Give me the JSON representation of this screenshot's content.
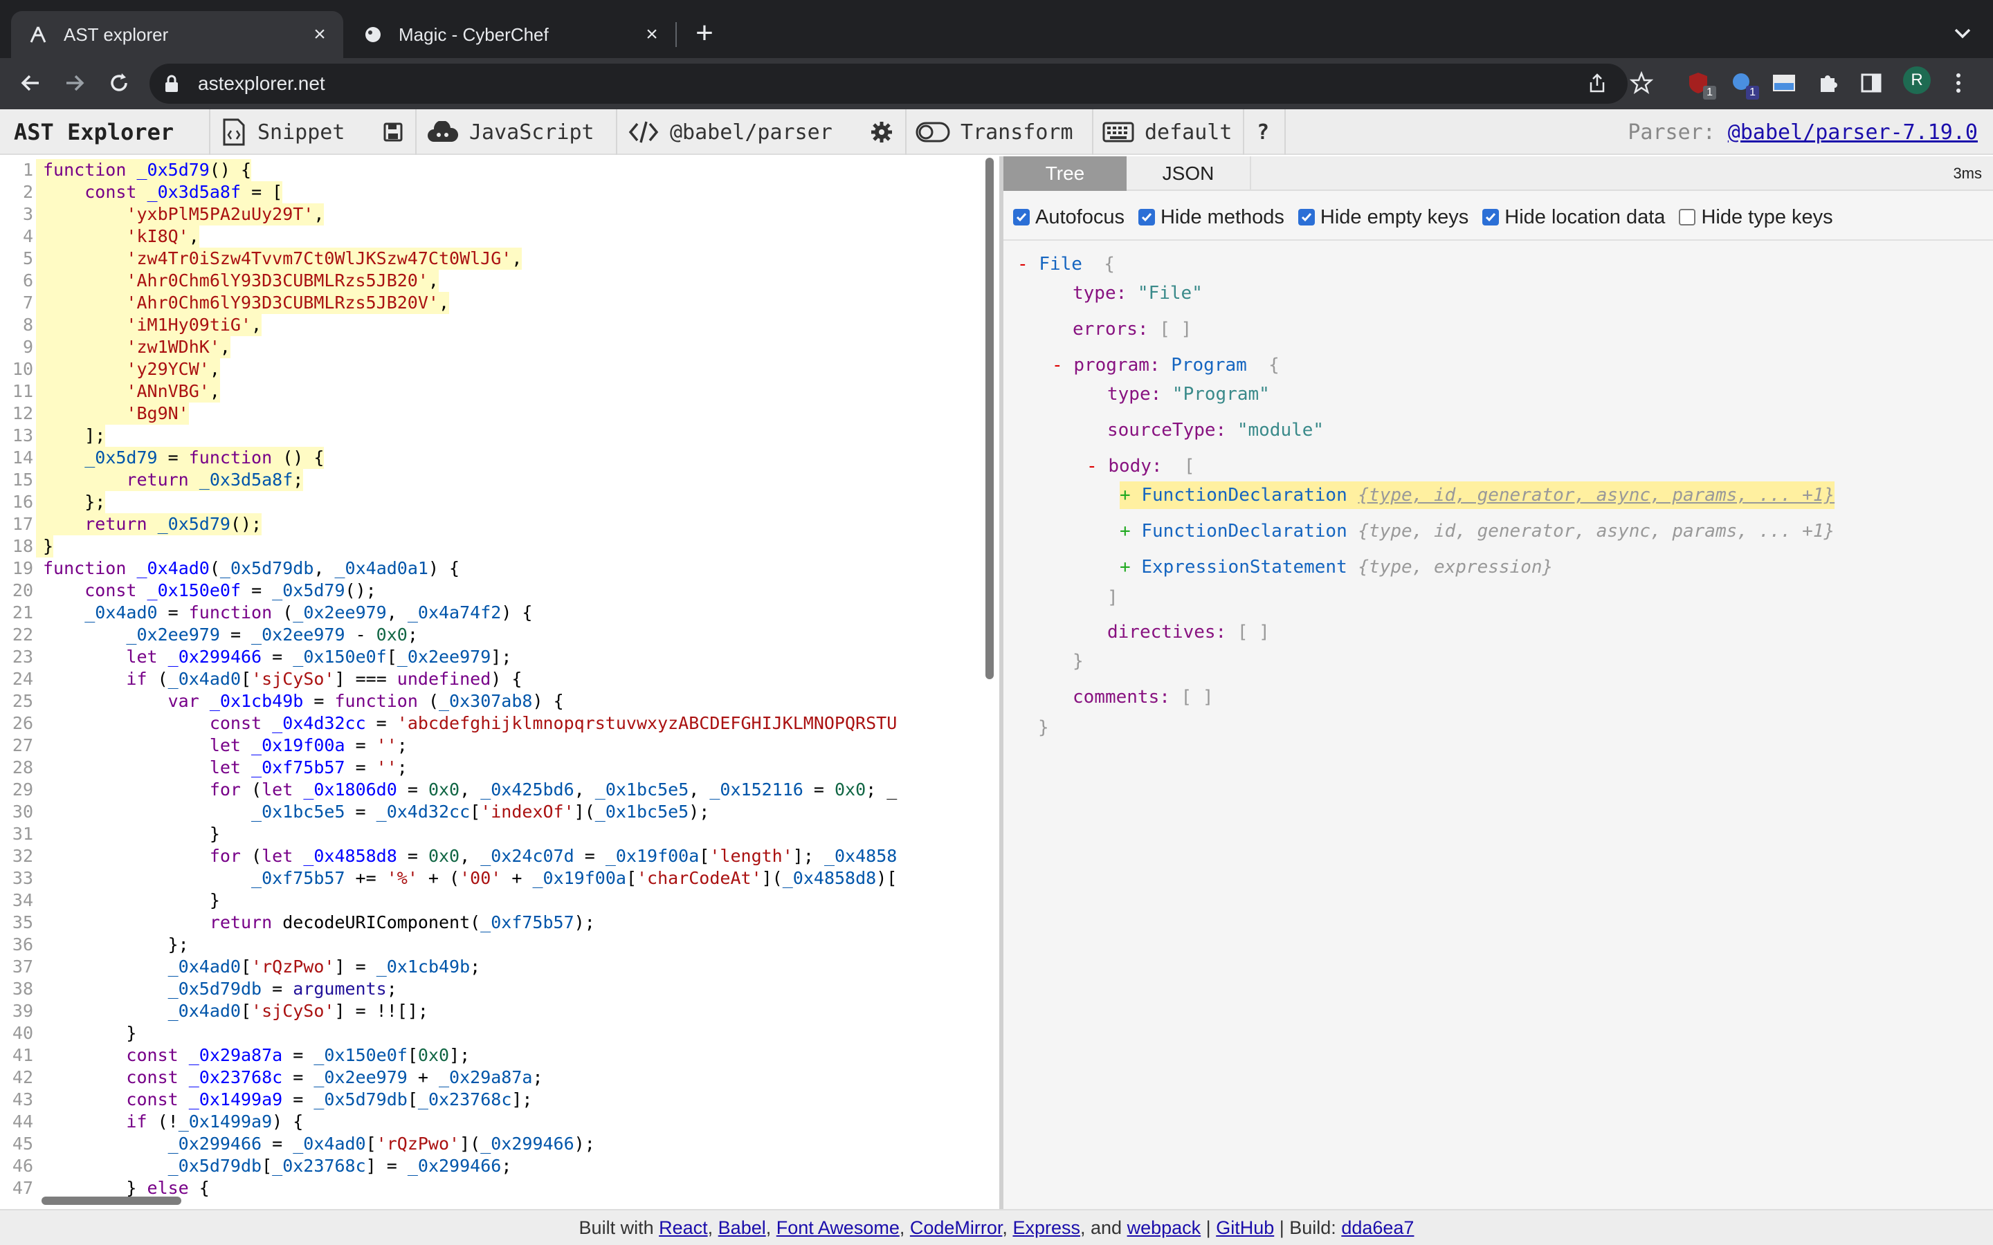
{
  "browser": {
    "tabs": [
      {
        "title": "AST explorer"
      },
      {
        "title": "Magic - CyberChef"
      }
    ],
    "url": "astexplorer.net",
    "extensions": [
      {
        "name": "ublock-icon",
        "badge": "1"
      },
      {
        "name": "extension-icon",
        "badge": "1"
      },
      {
        "name": "video-extension-icon",
        "badge": ""
      }
    ],
    "avatar_letter": "R"
  },
  "app": {
    "brand": "AST Explorer",
    "snippet": "Snippet",
    "language": "JavaScript",
    "parser": "@babel/parser",
    "transform": "Transform",
    "keymap": "default",
    "help": "?",
    "parser_label": "Parser:",
    "parser_version": "@babel/parser-7.19.0"
  },
  "editor": {
    "lines": [
      "function _0x5d79() {",
      "    const _0x3d5a8f = [",
      "        'yxbPlM5PA2uUy29T',",
      "        'kI8Q',",
      "        'zw4Tr0iSzw4Tvvm7Ct0WlJKSzw47Ct0WlJG',",
      "        'Ahr0Chm6lY93D3CUBMLRzs5JB20',",
      "        'Ahr0Chm6lY93D3CUBMLRzs5JB20V',",
      "        'iM1Hy09tiG',",
      "        'zw1WDhK',",
      "        'y29YCW',",
      "        'ANnVBG',",
      "        'Bg9N'",
      "    ];",
      "    _0x5d79 = function () {",
      "        return _0x3d5a8f;",
      "    };",
      "    return _0x5d79();",
      "}",
      "function _0x4ad0(_0x5d79db, _0x4ad0a1) {",
      "    const _0x150e0f = _0x5d79();",
      "    _0x4ad0 = function (_0x2ee979, _0x4a74f2) {",
      "        _0x2ee979 = _0x2ee979 - 0x0;",
      "        let _0x299466 = _0x150e0f[_0x2ee979];",
      "        if (_0x4ad0['sjCySo'] === undefined) {",
      "            var _0x1cb49b = function (_0x307ab8) {",
      "                const _0x4d32cc = 'abcdefghijklmnopqrstuvwxyzABCDEFGHIJKLMNOPQRSTU",
      "                let _0x19f00a = '';",
      "                let _0xf75b57 = '';",
      "                for (let _0x1806d0 = 0x0, _0x425bd6, _0x1bc5e5, _0x152116 = 0x0; _",
      "                    _0x1bc5e5 = _0x4d32cc['indexOf'](_0x1bc5e5);",
      "                }",
      "                for (let _0x4858d8 = 0x0, _0x24c07d = _0x19f00a['length']; _0x4858",
      "                    _0xf75b57 += '%' + ('00' + _0x19f00a['charCodeAt'](_0x4858d8)[",
      "                }",
      "                return decodeURIComponent(_0xf75b57);",
      "            };",
      "            _0x4ad0['rQzPwo'] = _0x1cb49b;",
      "            _0x5d79db = arguments;",
      "            _0x4ad0['sjCySo'] = !![];",
      "        }",
      "        const _0x29a87a = _0x150e0f[0x0];",
      "        const _0x23768c = _0x2ee979 + _0x29a87a;",
      "        const _0x1499a9 = _0x5d79db[_0x23768c];",
      "        if (!_0x1499a9) {",
      "            _0x299466 = _0x4ad0['rQzPwo'](_0x299466);",
      "            _0x5d79db[_0x23768c] = _0x299466;",
      "        } else {"
    ]
  },
  "output": {
    "tabs": [
      "Tree",
      "JSON"
    ],
    "time": "3ms",
    "options": [
      {
        "label": "Autofocus",
        "checked": true
      },
      {
        "label": "Hide methods",
        "checked": true
      },
      {
        "label": "Hide empty keys",
        "checked": true
      },
      {
        "label": "Hide location data",
        "checked": true
      },
      {
        "label": "Hide type keys",
        "checked": false
      }
    ],
    "tree": {
      "root_type": "File",
      "type_value": "\"File\"",
      "program_type": "Program",
      "program_type_value": "\"Program\"",
      "source_type_value": "\"module\"",
      "body_items": [
        {
          "type": "FunctionDeclaration",
          "summary": "{type, id, generator, async, params, ... +1}"
        },
        {
          "type": "FunctionDeclaration",
          "summary": "{type, id, generator, async, params, ... +1}"
        },
        {
          "type": "ExpressionStatement",
          "summary": "{type, expression}"
        }
      ]
    }
  },
  "footer": {
    "built_with": "Built with",
    "links": [
      "React",
      "Babel",
      "Font Awesome",
      "CodeMirror",
      "Express",
      "webpack"
    ],
    "and": "and",
    "github": "GitHub",
    "build_label": "Build:",
    "build_hash": "dda6ea7"
  }
}
